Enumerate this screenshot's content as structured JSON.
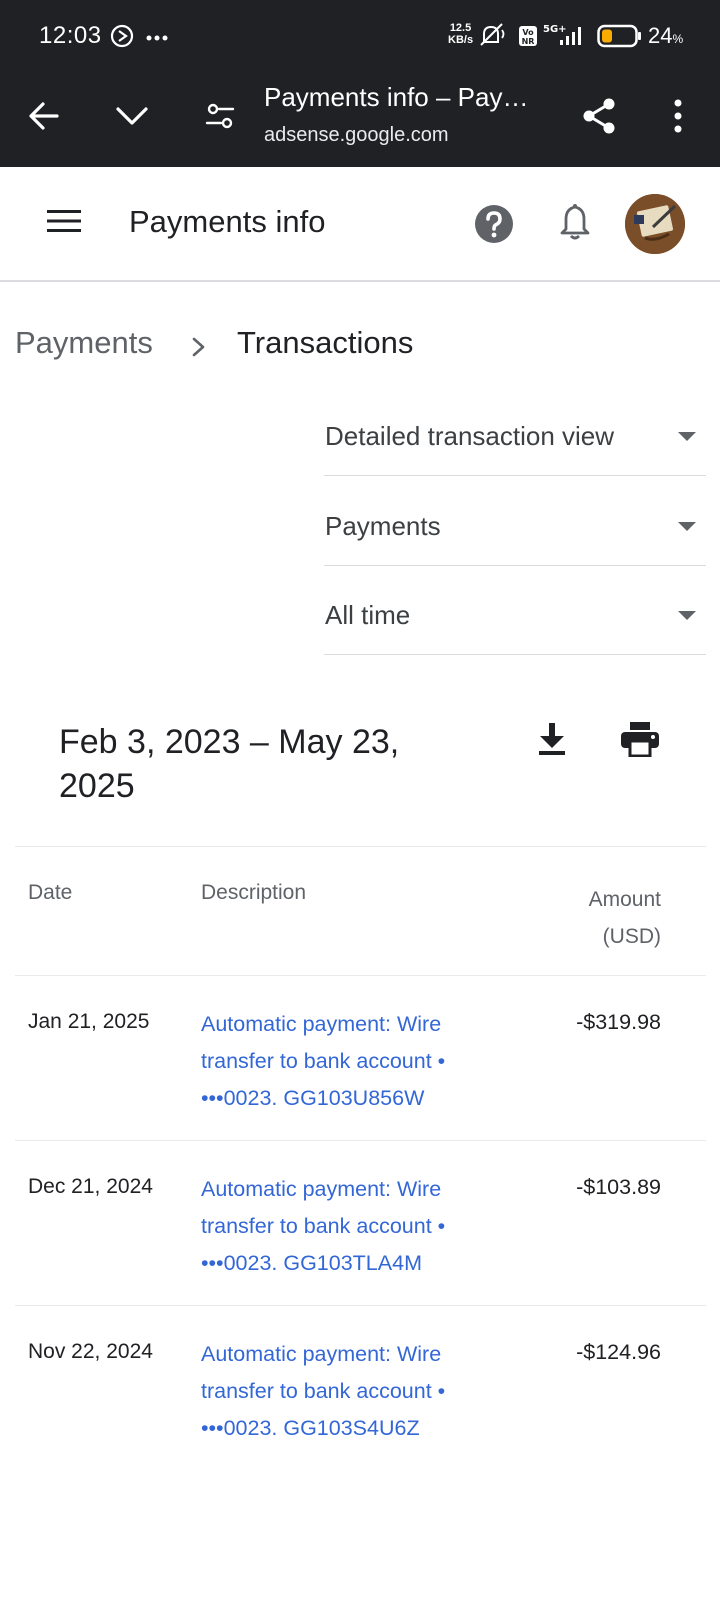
{
  "status_bar": {
    "time": "12:03",
    "net_speed_value": "12.5",
    "net_speed_unit": "KB/s",
    "battery_percent": "24",
    "battery_unit": "%"
  },
  "browser": {
    "tab_title": "Payments info – Pay…",
    "url": "adsense.google.com"
  },
  "app_header": {
    "title": "Payments info"
  },
  "breadcrumb": {
    "parent": "Payments",
    "current": "Transactions"
  },
  "filters": [
    {
      "label": "Detailed transaction view"
    },
    {
      "label": "Payments"
    },
    {
      "label": "All time"
    }
  ],
  "range": {
    "title": "Feb 3, 2023 – May 23, 2025"
  },
  "table": {
    "headers": {
      "date": "Date",
      "description": "Description",
      "amount": "Amount",
      "amount_unit": "(USD)"
    },
    "rows": [
      {
        "date": "Jan 21, 2025",
        "description": "Automatic payment: Wire transfer to bank account • •••0023. GG103U856W",
        "amount": "-$319.98"
      },
      {
        "date": "Dec 21, 2024",
        "description": "Automatic payment: Wire transfer to bank account • •••0023. GG103TLA4M",
        "amount": "-$103.89"
      },
      {
        "date": "Nov 22, 2024",
        "description": "Automatic payment: Wire transfer to bank account • •••0023. GG103S4U6Z",
        "amount": "-$124.96"
      }
    ]
  },
  "colors": {
    "toolbar_bg": "#202124",
    "link": "#3367d6",
    "divider": "#dadce0",
    "battery_fill": "#f9ab00"
  },
  "icons": {
    "toolbar": [
      "back-arrow-icon",
      "chevron-down-icon",
      "tune-icon",
      "share-icon",
      "more-vert-icon"
    ],
    "header": [
      "menu-icon",
      "help-icon",
      "bell-icon",
      "avatar"
    ],
    "actions": [
      "download-icon",
      "print-icon"
    ]
  }
}
